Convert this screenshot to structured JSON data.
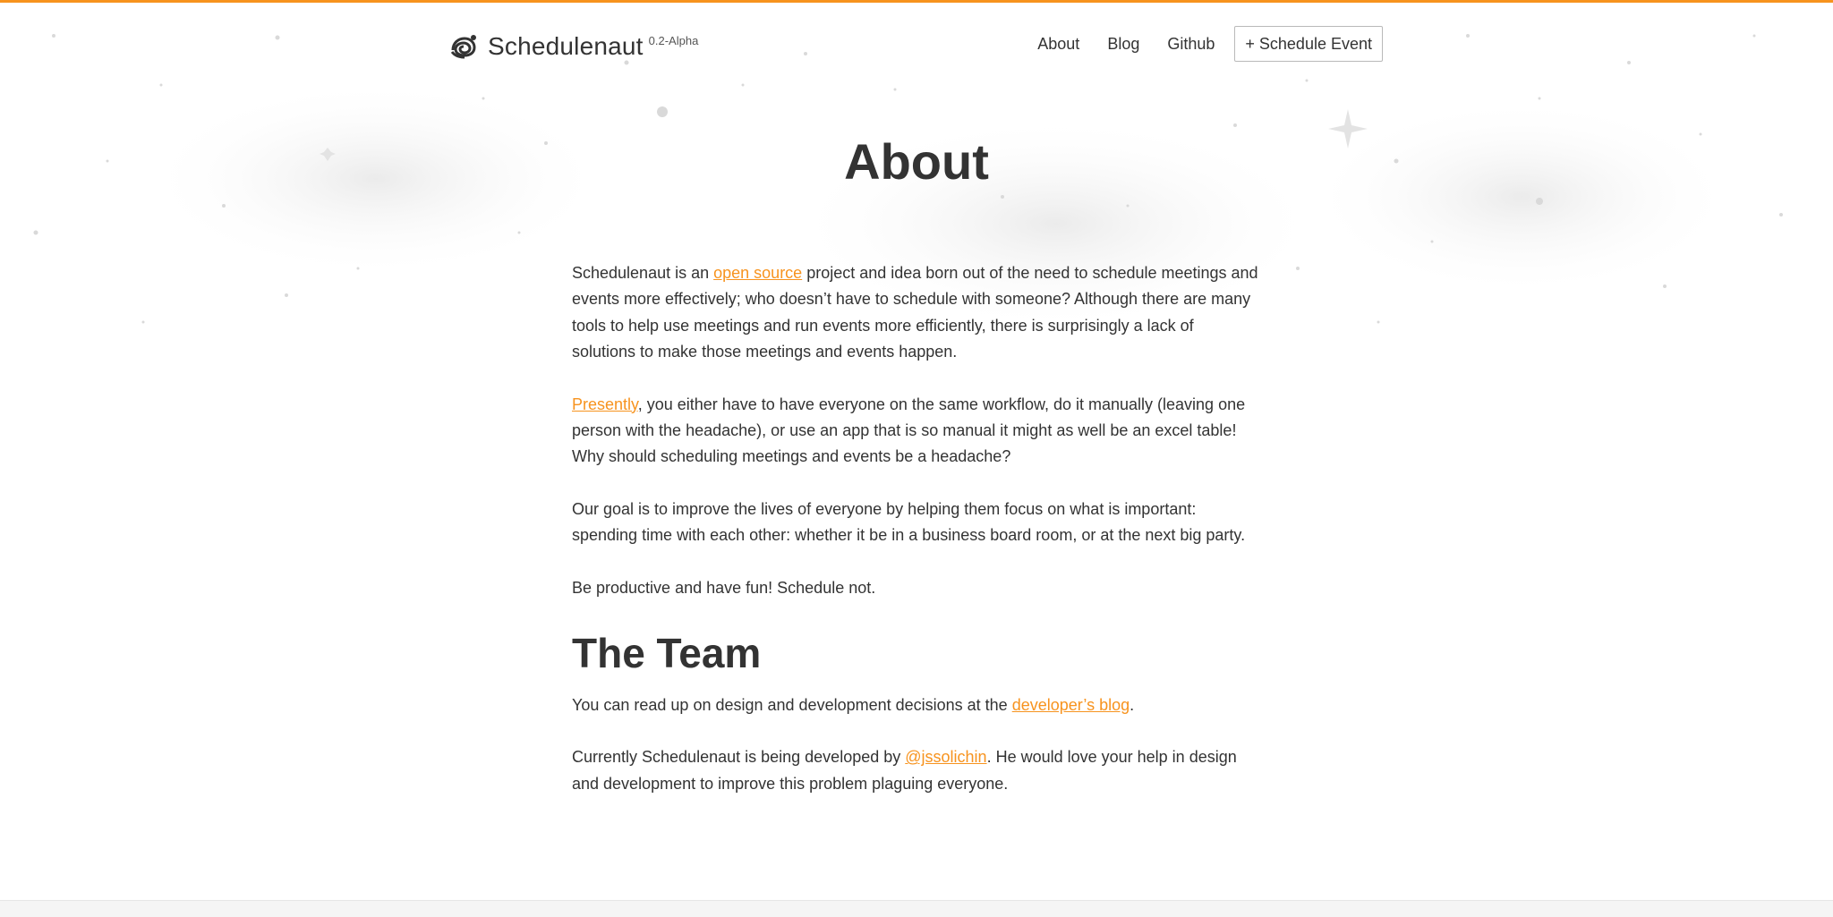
{
  "brand": {
    "name": "Schedulenaut",
    "version": "0.2-Alpha"
  },
  "nav": {
    "items": [
      {
        "label": "About"
      },
      {
        "label": "Blog"
      },
      {
        "label": "Github"
      }
    ],
    "cta_label": "+ Schedule Event"
  },
  "page": {
    "title": "About"
  },
  "about": {
    "p1": {
      "before": "Schedulenaut is an ",
      "link": "open source",
      "after": " project and idea born out of the need to schedule meetings and events more effectively; who doesn’t have to schedule with someone? Although there are many tools to help use meetings and run events more efficiently, there is surprisingly a lack of solutions to make those meetings and events happen."
    },
    "p2": {
      "link": "Presently",
      "after": ", you either have to have everyone on the same workflow, do it manually (leaving one person with the headache), or use an app that is so manual it might as well be an excel table! Why should scheduling meetings and events be a headache?"
    },
    "p3": "Our goal is to improve the lives of everyone by helping them focus on what is important: spending time with each other: whether it be in a business board room, or at the next big party.",
    "p4": "Be productive and have fun! Schedule not."
  },
  "team": {
    "heading": "The Team",
    "p1": {
      "before": "You can read up on design and development decisions at the ",
      "link": "developer’s blog",
      "after": "."
    },
    "p2": {
      "before": "Currently Schedulenaut is being developed by ",
      "link": "@jssolichin",
      "after": ". He would love your help in design and development to improve this problem plaguing everyone."
    }
  },
  "colors": {
    "accent": "#f7931e",
    "text": "#333333",
    "background": "#ffffff"
  },
  "icons": {
    "logo": "snail-astronaut-icon"
  }
}
